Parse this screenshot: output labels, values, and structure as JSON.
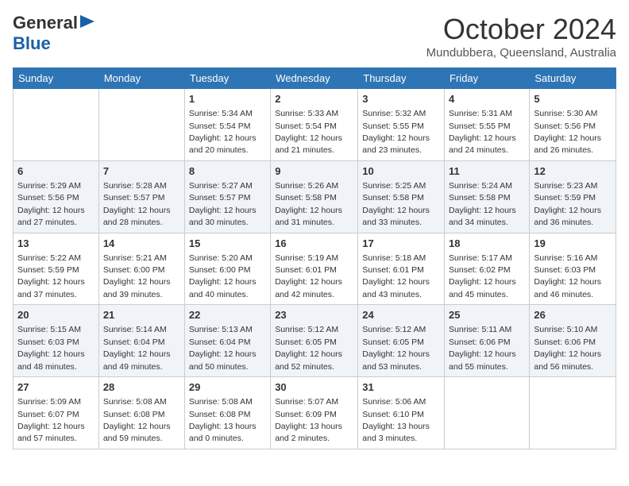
{
  "logo": {
    "line1": "General",
    "line2": "Blue"
  },
  "title": "October 2024",
  "subtitle": "Mundubbera, Queensland, Australia",
  "weekdays": [
    "Sunday",
    "Monday",
    "Tuesday",
    "Wednesday",
    "Thursday",
    "Friday",
    "Saturday"
  ],
  "weeks": [
    [
      {
        "day": "",
        "sunrise": "",
        "sunset": "",
        "daylight": ""
      },
      {
        "day": "",
        "sunrise": "",
        "sunset": "",
        "daylight": ""
      },
      {
        "day": "1",
        "sunrise": "Sunrise: 5:34 AM",
        "sunset": "Sunset: 5:54 PM",
        "daylight": "Daylight: 12 hours and 20 minutes."
      },
      {
        "day": "2",
        "sunrise": "Sunrise: 5:33 AM",
        "sunset": "Sunset: 5:54 PM",
        "daylight": "Daylight: 12 hours and 21 minutes."
      },
      {
        "day": "3",
        "sunrise": "Sunrise: 5:32 AM",
        "sunset": "Sunset: 5:55 PM",
        "daylight": "Daylight: 12 hours and 23 minutes."
      },
      {
        "day": "4",
        "sunrise": "Sunrise: 5:31 AM",
        "sunset": "Sunset: 5:55 PM",
        "daylight": "Daylight: 12 hours and 24 minutes."
      },
      {
        "day": "5",
        "sunrise": "Sunrise: 5:30 AM",
        "sunset": "Sunset: 5:56 PM",
        "daylight": "Daylight: 12 hours and 26 minutes."
      }
    ],
    [
      {
        "day": "6",
        "sunrise": "Sunrise: 5:29 AM",
        "sunset": "Sunset: 5:56 PM",
        "daylight": "Daylight: 12 hours and 27 minutes."
      },
      {
        "day": "7",
        "sunrise": "Sunrise: 5:28 AM",
        "sunset": "Sunset: 5:57 PM",
        "daylight": "Daylight: 12 hours and 28 minutes."
      },
      {
        "day": "8",
        "sunrise": "Sunrise: 5:27 AM",
        "sunset": "Sunset: 5:57 PM",
        "daylight": "Daylight: 12 hours and 30 minutes."
      },
      {
        "day": "9",
        "sunrise": "Sunrise: 5:26 AM",
        "sunset": "Sunset: 5:58 PM",
        "daylight": "Daylight: 12 hours and 31 minutes."
      },
      {
        "day": "10",
        "sunrise": "Sunrise: 5:25 AM",
        "sunset": "Sunset: 5:58 PM",
        "daylight": "Daylight: 12 hours and 33 minutes."
      },
      {
        "day": "11",
        "sunrise": "Sunrise: 5:24 AM",
        "sunset": "Sunset: 5:58 PM",
        "daylight": "Daylight: 12 hours and 34 minutes."
      },
      {
        "day": "12",
        "sunrise": "Sunrise: 5:23 AM",
        "sunset": "Sunset: 5:59 PM",
        "daylight": "Daylight: 12 hours and 36 minutes."
      }
    ],
    [
      {
        "day": "13",
        "sunrise": "Sunrise: 5:22 AM",
        "sunset": "Sunset: 5:59 PM",
        "daylight": "Daylight: 12 hours and 37 minutes."
      },
      {
        "day": "14",
        "sunrise": "Sunrise: 5:21 AM",
        "sunset": "Sunset: 6:00 PM",
        "daylight": "Daylight: 12 hours and 39 minutes."
      },
      {
        "day": "15",
        "sunrise": "Sunrise: 5:20 AM",
        "sunset": "Sunset: 6:00 PM",
        "daylight": "Daylight: 12 hours and 40 minutes."
      },
      {
        "day": "16",
        "sunrise": "Sunrise: 5:19 AM",
        "sunset": "Sunset: 6:01 PM",
        "daylight": "Daylight: 12 hours and 42 minutes."
      },
      {
        "day": "17",
        "sunrise": "Sunrise: 5:18 AM",
        "sunset": "Sunset: 6:01 PM",
        "daylight": "Daylight: 12 hours and 43 minutes."
      },
      {
        "day": "18",
        "sunrise": "Sunrise: 5:17 AM",
        "sunset": "Sunset: 6:02 PM",
        "daylight": "Daylight: 12 hours and 45 minutes."
      },
      {
        "day": "19",
        "sunrise": "Sunrise: 5:16 AM",
        "sunset": "Sunset: 6:03 PM",
        "daylight": "Daylight: 12 hours and 46 minutes."
      }
    ],
    [
      {
        "day": "20",
        "sunrise": "Sunrise: 5:15 AM",
        "sunset": "Sunset: 6:03 PM",
        "daylight": "Daylight: 12 hours and 48 minutes."
      },
      {
        "day": "21",
        "sunrise": "Sunrise: 5:14 AM",
        "sunset": "Sunset: 6:04 PM",
        "daylight": "Daylight: 12 hours and 49 minutes."
      },
      {
        "day": "22",
        "sunrise": "Sunrise: 5:13 AM",
        "sunset": "Sunset: 6:04 PM",
        "daylight": "Daylight: 12 hours and 50 minutes."
      },
      {
        "day": "23",
        "sunrise": "Sunrise: 5:12 AM",
        "sunset": "Sunset: 6:05 PM",
        "daylight": "Daylight: 12 hours and 52 minutes."
      },
      {
        "day": "24",
        "sunrise": "Sunrise: 5:12 AM",
        "sunset": "Sunset: 6:05 PM",
        "daylight": "Daylight: 12 hours and 53 minutes."
      },
      {
        "day": "25",
        "sunrise": "Sunrise: 5:11 AM",
        "sunset": "Sunset: 6:06 PM",
        "daylight": "Daylight: 12 hours and 55 minutes."
      },
      {
        "day": "26",
        "sunrise": "Sunrise: 5:10 AM",
        "sunset": "Sunset: 6:06 PM",
        "daylight": "Daylight: 12 hours and 56 minutes."
      }
    ],
    [
      {
        "day": "27",
        "sunrise": "Sunrise: 5:09 AM",
        "sunset": "Sunset: 6:07 PM",
        "daylight": "Daylight: 12 hours and 57 minutes."
      },
      {
        "day": "28",
        "sunrise": "Sunrise: 5:08 AM",
        "sunset": "Sunset: 6:08 PM",
        "daylight": "Daylight: 12 hours and 59 minutes."
      },
      {
        "day": "29",
        "sunrise": "Sunrise: 5:08 AM",
        "sunset": "Sunset: 6:08 PM",
        "daylight": "Daylight: 13 hours and 0 minutes."
      },
      {
        "day": "30",
        "sunrise": "Sunrise: 5:07 AM",
        "sunset": "Sunset: 6:09 PM",
        "daylight": "Daylight: 13 hours and 2 minutes."
      },
      {
        "day": "31",
        "sunrise": "Sunrise: 5:06 AM",
        "sunset": "Sunset: 6:10 PM",
        "daylight": "Daylight: 13 hours and 3 minutes."
      },
      {
        "day": "",
        "sunrise": "",
        "sunset": "",
        "daylight": ""
      },
      {
        "day": "",
        "sunrise": "",
        "sunset": "",
        "daylight": ""
      }
    ]
  ]
}
